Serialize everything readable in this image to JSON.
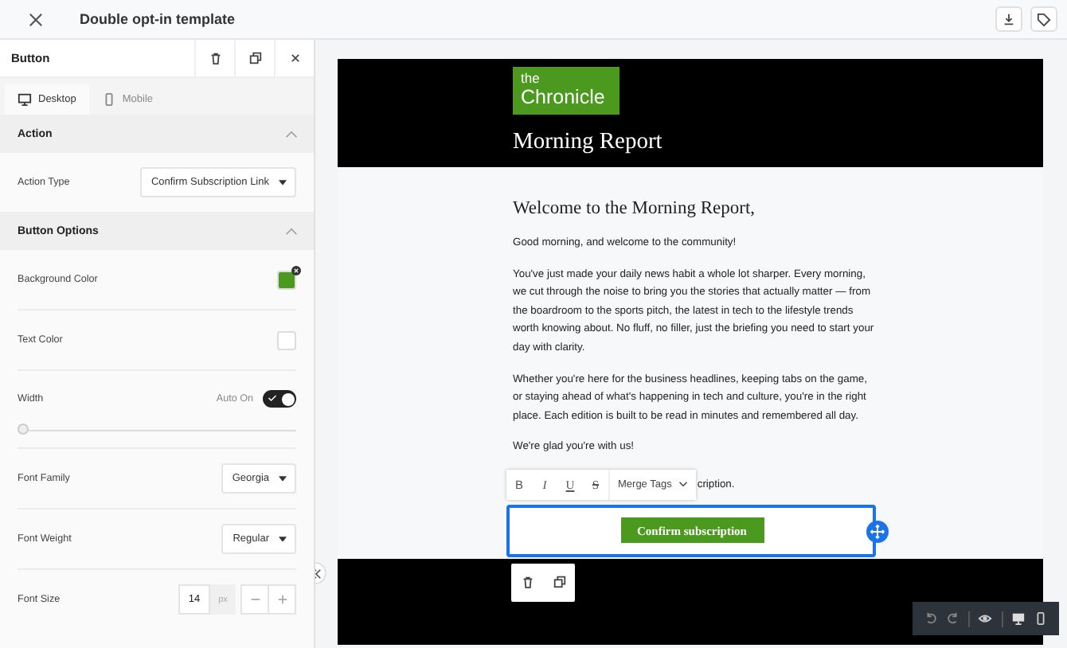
{
  "topbar": {
    "title": "Double opt-in template"
  },
  "panel": {
    "title": "Button",
    "view_tabs": [
      {
        "label": "Desktop",
        "selected": true,
        "kind": "desktop"
      },
      {
        "label": "Mobile",
        "selected": false,
        "kind": "mobile"
      }
    ],
    "sections": [
      {
        "title": "Action",
        "expanded": true,
        "fields": [
          {
            "kind": "select",
            "label": "Action Type",
            "value": "Confirm Subscription Link"
          }
        ]
      },
      {
        "title": "Button Options",
        "expanded": true,
        "fields": [
          {
            "kind": "color",
            "label": "Background Color",
            "color": "#4b9a1f"
          },
          {
            "kind": "color",
            "label": "Text Color",
            "color": "#ffffff"
          },
          {
            "kind": "toggle",
            "label": "Width",
            "toggle_label": "Auto On",
            "on": true,
            "level": 0
          },
          {
            "kind": "select",
            "label": "Font Family",
            "value": "Georgia"
          },
          {
            "kind": "select",
            "label": "Font Weight",
            "value": "Regular"
          },
          {
            "kind": "number",
            "label": "Font Size",
            "value": "14",
            "unit": "px"
          }
        ]
      }
    ]
  },
  "email": {
    "logo_small": "the",
    "logo_large": "Chronicle",
    "masthead": "Morning Report",
    "heading": "Welcome to the Morning Report,",
    "paragraphs": [
      "Good morning, and welcome to the community!",
      "You've just made your daily news habit a whole lot sharper. Every morning, we cut through the noise to bring you the stories that actually matter — from the boardroom to the sports pitch, the latest in tech to the lifestyle trends worth knowing about. No fluff, no filler, just the briefing you need to start your day with clarity.",
      "Whether you're here for the business headlines, keeping tabs on the game, or staying ahead of what's happening in tech and culture, you're in the right place. Each edition is built to be read in minutes and remembered all day.",
      "We're glad you're with us!"
    ],
    "partial_text": "cription.",
    "format_toolbar": [
      {
        "kind": "bold",
        "label": "B"
      },
      {
        "kind": "italic",
        "label": "I"
      },
      {
        "kind": "underline",
        "label": "U"
      },
      {
        "kind": "strike",
        "label": "S"
      }
    ],
    "merge_tags": "Merge Tags",
    "button": {
      "label": "Confirm subscription",
      "selected": true
    }
  }
}
